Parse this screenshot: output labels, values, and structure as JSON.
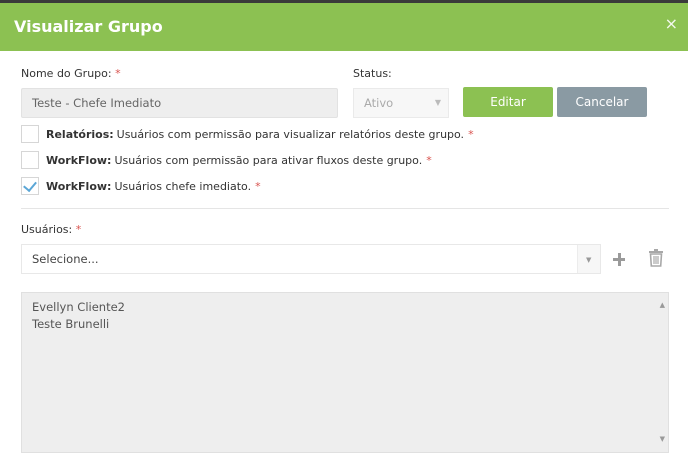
{
  "modal": {
    "title": "Visualizar Grupo",
    "close_glyph": "×"
  },
  "form": {
    "group_name": {
      "label": "Nome do Grupo:",
      "required": "*",
      "value": "Teste - Chefe Imediato"
    },
    "status": {
      "label": "Status:",
      "value": "Ativo"
    },
    "buttons": {
      "edit": "Editar",
      "cancel": "Cancelar"
    },
    "permissions": [
      {
        "bold": "Relatórios:",
        "text": "Usuários com permissão para visualizar relatórios deste grupo.",
        "required": "*",
        "checked": false
      },
      {
        "bold": "WorkFlow:",
        "text": "Usuários com permissão para ativar fluxos deste grupo.",
        "required": "*",
        "checked": false
      },
      {
        "bold": "WorkFlow:",
        "text": "Usuários chefe imediato.",
        "required": "*",
        "checked": true
      }
    ],
    "users": {
      "label": "Usuários:",
      "required": "*",
      "select_value": "Selecione...",
      "list": [
        "Evellyn Cliente2",
        "Teste Brunelli"
      ]
    }
  },
  "icons": {
    "close": "close-icon",
    "add": "plus-icon",
    "delete": "trash-icon",
    "caret": "chevron-down-icon",
    "check": "check-icon"
  },
  "colors": {
    "header": "#8cc152",
    "edit_button": "#8cc152",
    "cancel_button": "#8a9aa3",
    "required": "#d9534f",
    "check": "#5aa6d6"
  }
}
